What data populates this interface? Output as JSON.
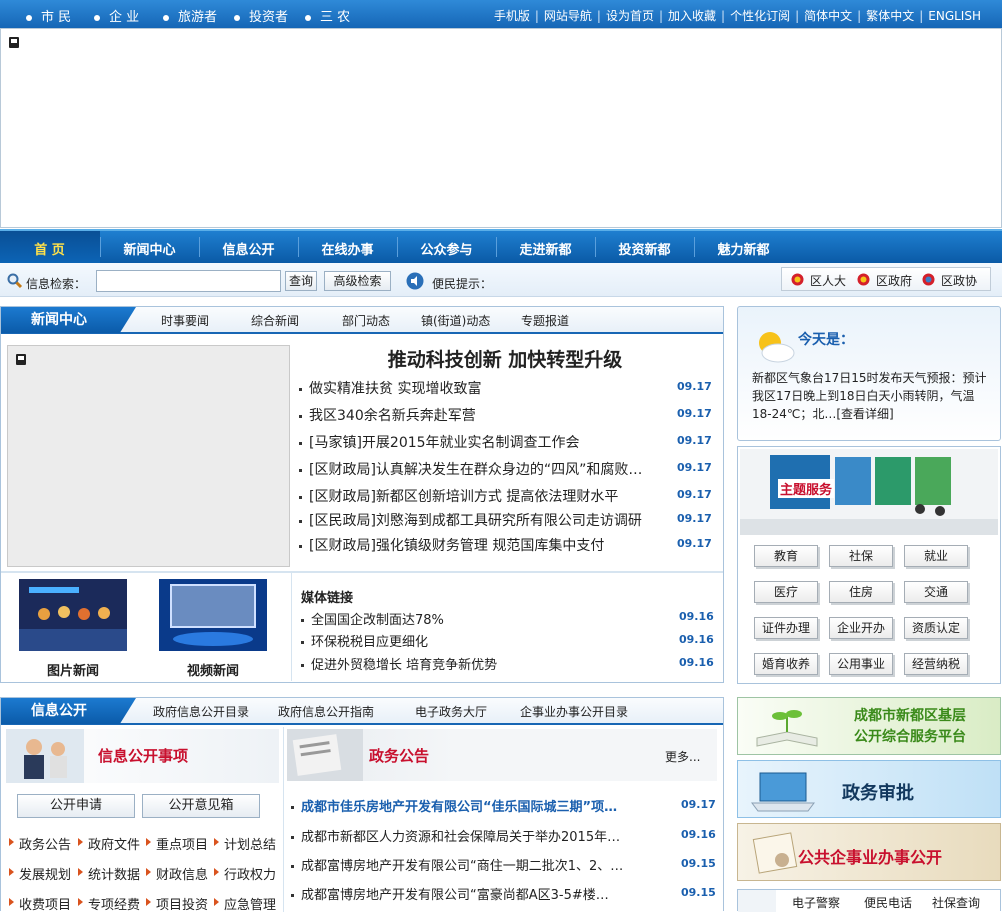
{
  "topbar": {
    "audiences": [
      "市 民",
      "企 业",
      "旅游者",
      "投资者",
      "三 农"
    ],
    "links": [
      "手机版",
      "网站导航",
      "设为首页",
      "加入收藏",
      "个性化订阅",
      "简体中文",
      "繁体中文",
      "ENGLISH"
    ]
  },
  "nav": {
    "items": [
      "首 页",
      "新闻中心",
      "信息公开",
      "在线办事",
      "公众参与",
      "走进新都",
      "投资新都",
      "魅力新都"
    ]
  },
  "search": {
    "label": "信息检索：",
    "query": "",
    "search_button": "查询",
    "advanced_button": "高级检索",
    "tip_label": "便民提示：",
    "right_links": [
      "区人大",
      "区政府",
      "区政协"
    ]
  },
  "news_center": {
    "title": "新闻中心",
    "tabs": [
      "时事要闻",
      "综合新闻",
      "部门动态",
      "镇(街道)动态",
      "专题报道"
    ],
    "headline": "推动科技创新  加快转型升级",
    "items": [
      {
        "text": "做实精准扶贫  实现增收致富",
        "date": "09.17"
      },
      {
        "text": "我区340余名新兵奔赴军营",
        "date": "09.17"
      },
      {
        "text": "[马家镇]开展2015年就业实名制调查工作会",
        "date": "09.17"
      },
      {
        "text": "[区财政局]认真解决发生在群众身边的“四风”和腐败…",
        "date": "09.17"
      },
      {
        "text": "[区财政局]新都区创新培训方式 提高依法理财水平",
        "date": "09.17"
      },
      {
        "text": "[区民政局]刘愍海到成都工具研究所有限公司走访调研",
        "date": "09.17"
      },
      {
        "text": "[区财政局]强化镇级财务管理   规范国库集中支付",
        "date": "09.17"
      }
    ],
    "photo_label": "图片新闻",
    "video_label": "视频新闻",
    "media_title": "媒体链接",
    "media_items": [
      {
        "text": "全国国企改制面达78%",
        "date": "09.16"
      },
      {
        "text": "环保税税目应更细化",
        "date": "09.16"
      },
      {
        "text": "促进外贸稳增长 培育竞争新优势",
        "date": "09.16"
      }
    ]
  },
  "weather": {
    "title": "今天是：",
    "text": "新都区气象台17日15时发布天气预报：预计我区17日晚上到18日白天小雨转阴，气温18-24℃；北…[查看详细]"
  },
  "services": {
    "title": "主题服务",
    "buttons": [
      "教育",
      "社保",
      "就业",
      "医疗",
      "住房",
      "交通",
      "证件办理",
      "企业开办",
      "资质认定",
      "婚育收养",
      "公用事业",
      "经营纳税"
    ]
  },
  "info_public": {
    "title": "信息公开",
    "tabs": [
      "政府信息公开目录",
      "政府信息公开指南",
      "电子政务大厅",
      "企事业办事公开目录"
    ],
    "matters_title": "信息公开事项",
    "apply_button": "公开申请",
    "opinion_button": "公开意见箱",
    "grid": [
      "政务公告",
      "政府文件",
      "重点项目",
      "计划总结",
      "发展规划",
      "统计数据",
      "财政信息",
      "行政权力",
      "收费项目",
      "专项经费",
      "项目投资",
      "应急管理"
    ],
    "notice_title": "政务公告",
    "more": "更多...",
    "notices": [
      {
        "text": "成都市佳乐房地产开发有限公司“佳乐国际城三期”项…",
        "date": "09.17"
      },
      {
        "text": "成都市新都区人力资源和社会保障局关于举办2015年…",
        "date": "09.16"
      },
      {
        "text": "成都富博房地产开发有限公司“商住一期二批次1、2、…",
        "date": "09.15"
      },
      {
        "text": "成都富博房地产开发有限公司“富豪尚都A区3-5#楼…",
        "date": "09.15"
      }
    ]
  },
  "side_links": {
    "platform": "成都市新都区基层\n公开综合服务平台",
    "approval": "政务审批",
    "public_affairs": "公共企事业办事公开",
    "bottom": [
      "电子警察",
      "便民电话",
      "社保查询"
    ]
  },
  "colors": {
    "brand_blue": "#0b5ba9",
    "red_title": "#c8102e",
    "date_blue": "#1a5fae"
  }
}
